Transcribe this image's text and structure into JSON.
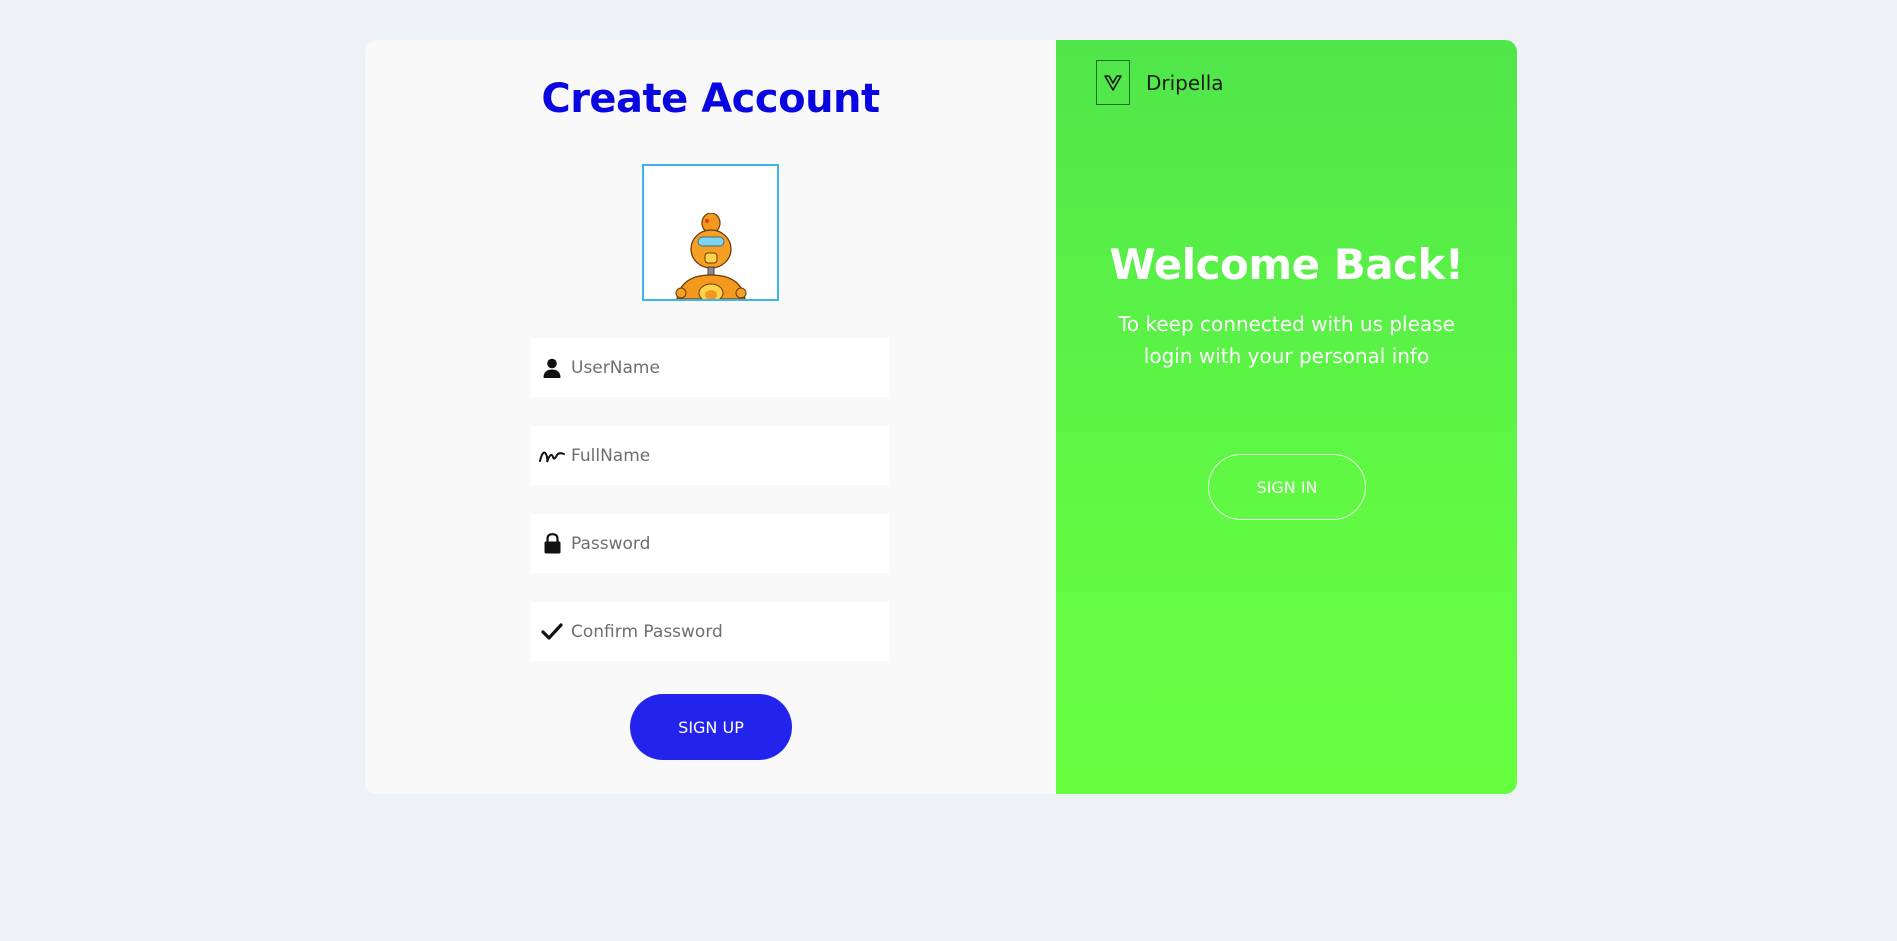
{
  "signup": {
    "title": "Create Account",
    "fields": [
      {
        "icon": "user-icon",
        "placeholder": "UserName"
      },
      {
        "icon": "signature-icon",
        "placeholder": "FullName"
      },
      {
        "icon": "lock-icon",
        "placeholder": "Password"
      },
      {
        "icon": "check-icon",
        "placeholder": "Confirm Password"
      }
    ],
    "button_label": "SIGN UP",
    "avatar_icon": "robot-avatar"
  },
  "panel": {
    "brand_name": "Dripella",
    "logo_icon": "vue-logo-icon",
    "heading": "Welcome Back!",
    "subtext": "To keep connected with us please login with your personal info",
    "button_label": "SIGN IN"
  },
  "colors": {
    "title": "#0a06e0",
    "signup_button": "#2323ee",
    "panel_green": "#5cf044",
    "avatar_border": "#3fb3f0",
    "background": "#eef1f6"
  }
}
